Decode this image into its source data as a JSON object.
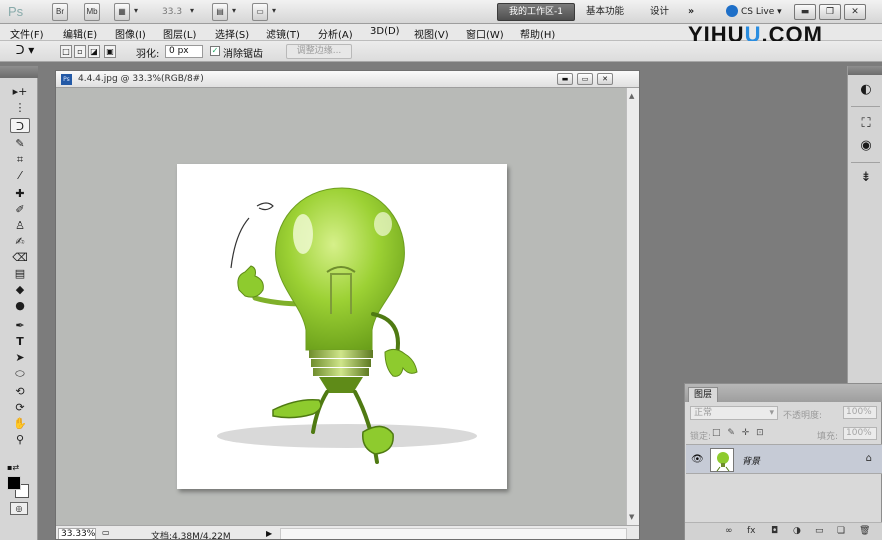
{
  "app_bar": {
    "logo": "Ps",
    "icons": [
      "bridge-icon",
      "mini-bridge-icon",
      "view-extras-icon",
      "zoom-level",
      "arrange-documents-icon",
      "screen-mode-icon"
    ],
    "br_label": "Br",
    "mb_label": "Mb",
    "zoom": "33.3",
    "workspace_active": "我的工作区-1",
    "workspace_essentials": "基本功能",
    "workspace_design": "设计",
    "more": "»",
    "cs_live": "CS Live"
  },
  "watermark": {
    "part1": "YIHU",
    "part2": "U",
    "part3": ".COM"
  },
  "menu": [
    "文件(F)",
    "编辑(E)",
    "图像(I)",
    "图层(L)",
    "选择(S)",
    "滤镜(T)",
    "分析(A)",
    "3D(D)",
    "视图(V)",
    "窗口(W)",
    "帮助(H)"
  ],
  "options": {
    "feather_label": "羽化:",
    "feather_value": "0 px",
    "antialias_label": "消除锯齿",
    "antialias_checked": "✓",
    "refine_edge": "调整边缘..."
  },
  "document": {
    "title": "4.4.4.jpg @ 33.3%(RGB/8#)",
    "ps_badge": "Ps",
    "status_zoom": "33.33%",
    "status_info": "文档:4.38M/4.22M"
  },
  "layers": {
    "tab": "图层",
    "blend_mode": "正常",
    "opacity_label": "不透明度:",
    "opacity_value": "100%",
    "lock_label": "锁定:",
    "fill_label": "填充:",
    "fill_value": "100%",
    "layer_name": "背景"
  },
  "colors": {
    "foreground": "#000000",
    "background": "#ffffff",
    "bulb_green": "#8ecb2e",
    "selection_bar": "#c6cbd6"
  }
}
